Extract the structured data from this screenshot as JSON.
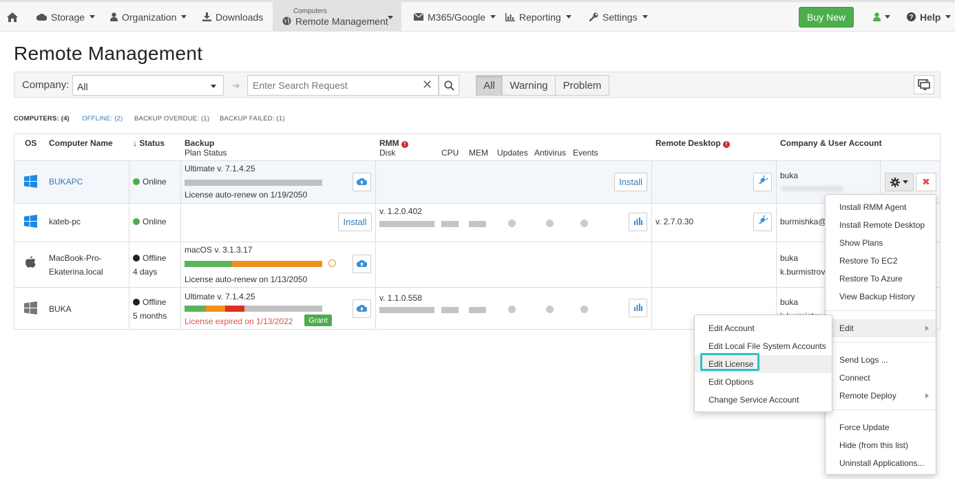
{
  "nav": {
    "storage": "Storage",
    "organization": "Organization",
    "downloads": "Downloads",
    "computers_small": "Computers",
    "remote_management": "Remote Management",
    "m365": "M365/Google",
    "reporting": "Reporting",
    "settings": "Settings",
    "buy_new": "Buy New",
    "help": "Help"
  },
  "page_title": "Remote Management",
  "filter": {
    "company_label": "Company:",
    "company_value": "All",
    "search_placeholder": "Enter Search Request",
    "seg_all": "All",
    "seg_warning": "Warning",
    "seg_problem": "Problem"
  },
  "summary": {
    "computers": "COMPUTERS: (4)",
    "offline": "OFFLINE: (2)",
    "backup_overdue": "BACKUP OVERDUE: (1)",
    "backup_failed": "BACKUP FAILED: (1)"
  },
  "columns": {
    "os": "OS",
    "computer_name": "Computer Name",
    "status": "Status",
    "backup": "Backup",
    "plan_status": "Plan Status",
    "rmm": "RMM",
    "disk": "Disk",
    "cpu": "CPU",
    "mem": "MEM",
    "updates": "Updates",
    "antivirus": "Antivirus",
    "events": "Events",
    "remote_desktop": "Remote Desktop",
    "company_user": "Company & User Account"
  },
  "rows": [
    {
      "name": "BUKAPC",
      "status": "Online",
      "status2": "",
      "backup_version": "Ultimate v. 7.1.4.25",
      "backup_license": "License auto-renew on 1/19/2050",
      "rmm_install": "Install",
      "user": "buka"
    },
    {
      "name": "kateb-pc",
      "status": "Online",
      "status2": "",
      "backup_install": "Install",
      "rmm_version": "v. 1.2.0.402",
      "rd_version": "v. 2.7.0.30",
      "user": "burmishka@"
    },
    {
      "name": "MacBook-Pro-",
      "name2": "Ekaterina.local",
      "status": "Offline",
      "status2": "4 days",
      "backup_version": "macOS v. 3.1.3.17",
      "backup_license": "License auto-renew on 1/13/2050",
      "user": "buka",
      "user2": "k.burmistrov"
    },
    {
      "name": "BUKA",
      "status": "Offline",
      "status2": "5 months",
      "backup_version": "Ultimate v. 7.1.4.25",
      "backup_license": "License expired on 1/13/2022",
      "grant": "Grant",
      "rmm_version": "v. 1.1.0.558",
      "user": "buka",
      "user2": "k.burmistrov"
    }
  ],
  "context_menu": {
    "items": [
      "Install RMM Agent",
      "Install Remote Desktop",
      "Show Plans",
      "Restore To EC2",
      "Restore To Azure",
      "View Backup History",
      "Edit",
      "Send Logs ...",
      "Connect",
      "Remote Deploy",
      "Force Update",
      "Hide (from this list)",
      "Uninstall Applications..."
    ]
  },
  "edit_submenu": {
    "items": [
      "Edit Account",
      "Edit Local File System Accounts",
      "Edit License",
      "Edit Options",
      "Change Service Account"
    ]
  },
  "colors": {
    "green": "#4cae4c",
    "orange": "#f0901e",
    "red": "#e0301e",
    "link": "#337ab7",
    "highlight": "#2fc1c1"
  }
}
